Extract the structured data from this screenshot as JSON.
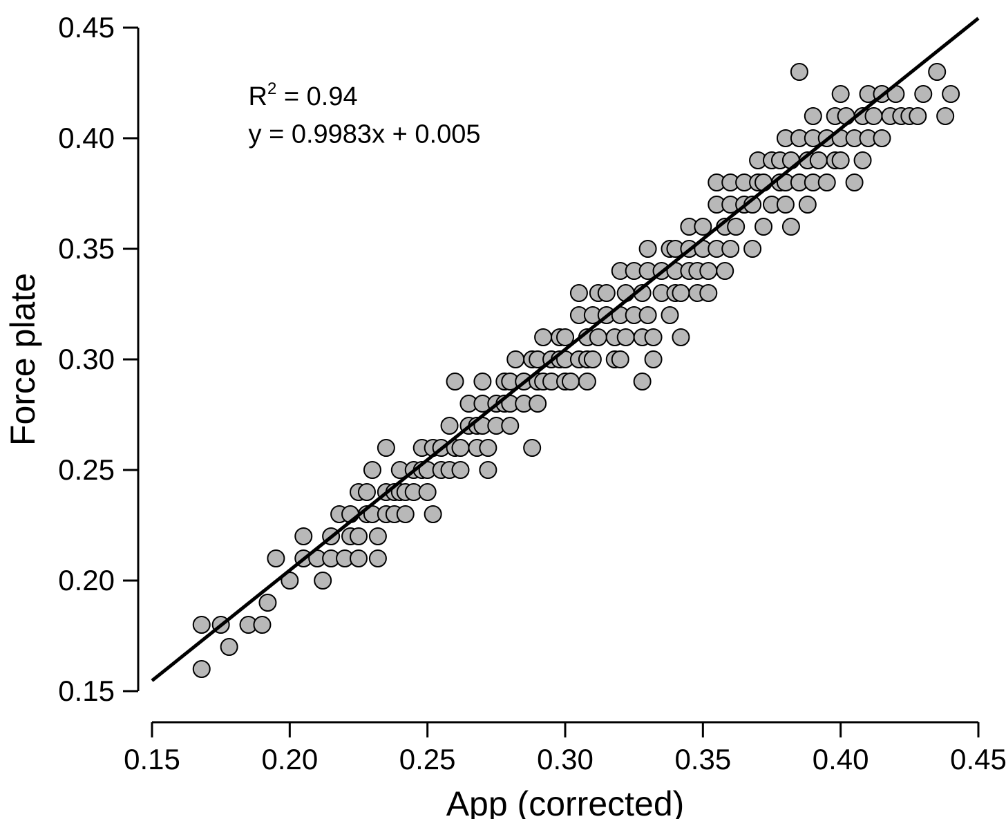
{
  "chart_data": {
    "type": "scatter",
    "xlabel": "App (corrected)",
    "ylabel": "Force plate",
    "xlim": [
      0.15,
      0.45
    ],
    "ylim": [
      0.15,
      0.45
    ],
    "xticks": [
      0.15,
      0.2,
      0.25,
      0.3,
      0.35,
      0.4,
      0.45
    ],
    "yticks": [
      0.15,
      0.2,
      0.25,
      0.3,
      0.35,
      0.4,
      0.45
    ],
    "xtick_labels": [
      "0.15",
      "0.20",
      "0.25",
      "0.30",
      "0.35",
      "0.40",
      "0.45"
    ],
    "ytick_labels": [
      "0.15",
      "0.20",
      "0.25",
      "0.30",
      "0.35",
      "0.40",
      "0.45"
    ],
    "annotations": {
      "r2_label": "R",
      "r2_sup": "2",
      "r2_rest": " = 0.94",
      "equation": "y = 0.9983x + 0.005"
    },
    "regression": {
      "slope": 0.9983,
      "intercept": 0.005,
      "x_start": 0.15,
      "x_end": 0.45
    },
    "points": [
      [
        0.168,
        0.16
      ],
      [
        0.168,
        0.18
      ],
      [
        0.175,
        0.18
      ],
      [
        0.178,
        0.17
      ],
      [
        0.185,
        0.18
      ],
      [
        0.19,
        0.18
      ],
      [
        0.192,
        0.19
      ],
      [
        0.195,
        0.21
      ],
      [
        0.2,
        0.2
      ],
      [
        0.205,
        0.21
      ],
      [
        0.205,
        0.22
      ],
      [
        0.21,
        0.21
      ],
      [
        0.212,
        0.2
      ],
      [
        0.215,
        0.21
      ],
      [
        0.215,
        0.22
      ],
      [
        0.218,
        0.23
      ],
      [
        0.22,
        0.21
      ],
      [
        0.222,
        0.22
      ],
      [
        0.222,
        0.23
      ],
      [
        0.225,
        0.24
      ],
      [
        0.225,
        0.22
      ],
      [
        0.225,
        0.21
      ],
      [
        0.228,
        0.23
      ],
      [
        0.228,
        0.24
      ],
      [
        0.23,
        0.23
      ],
      [
        0.23,
        0.25
      ],
      [
        0.232,
        0.21
      ],
      [
        0.232,
        0.22
      ],
      [
        0.235,
        0.23
      ],
      [
        0.235,
        0.24
      ],
      [
        0.235,
        0.26
      ],
      [
        0.238,
        0.23
      ],
      [
        0.238,
        0.24
      ],
      [
        0.24,
        0.24
      ],
      [
        0.24,
        0.25
      ],
      [
        0.242,
        0.23
      ],
      [
        0.242,
        0.24
      ],
      [
        0.245,
        0.25
      ],
      [
        0.245,
        0.24
      ],
      [
        0.248,
        0.25
      ],
      [
        0.248,
        0.26
      ],
      [
        0.25,
        0.25
      ],
      [
        0.25,
        0.24
      ],
      [
        0.252,
        0.23
      ],
      [
        0.252,
        0.26
      ],
      [
        0.255,
        0.25
      ],
      [
        0.255,
        0.26
      ],
      [
        0.258,
        0.25
      ],
      [
        0.258,
        0.27
      ],
      [
        0.26,
        0.26
      ],
      [
        0.26,
        0.29
      ],
      [
        0.262,
        0.25
      ],
      [
        0.262,
        0.26
      ],
      [
        0.265,
        0.27
      ],
      [
        0.265,
        0.28
      ],
      [
        0.268,
        0.26
      ],
      [
        0.268,
        0.27
      ],
      [
        0.27,
        0.27
      ],
      [
        0.27,
        0.28
      ],
      [
        0.27,
        0.29
      ],
      [
        0.272,
        0.26
      ],
      [
        0.272,
        0.25
      ],
      [
        0.275,
        0.27
      ],
      [
        0.275,
        0.28
      ],
      [
        0.278,
        0.28
      ],
      [
        0.278,
        0.29
      ],
      [
        0.28,
        0.28
      ],
      [
        0.28,
        0.29
      ],
      [
        0.28,
        0.27
      ],
      [
        0.282,
        0.3
      ],
      [
        0.285,
        0.28
      ],
      [
        0.285,
        0.29
      ],
      [
        0.288,
        0.3
      ],
      [
        0.288,
        0.26
      ],
      [
        0.29,
        0.28
      ],
      [
        0.29,
        0.29
      ],
      [
        0.29,
        0.3
      ],
      [
        0.292,
        0.29
      ],
      [
        0.292,
        0.31
      ],
      [
        0.295,
        0.29
      ],
      [
        0.295,
        0.3
      ],
      [
        0.298,
        0.3
      ],
      [
        0.298,
        0.31
      ],
      [
        0.3,
        0.29
      ],
      [
        0.3,
        0.3
      ],
      [
        0.3,
        0.31
      ],
      [
        0.302,
        0.29
      ],
      [
        0.305,
        0.3
      ],
      [
        0.305,
        0.32
      ],
      [
        0.305,
        0.33
      ],
      [
        0.308,
        0.29
      ],
      [
        0.308,
        0.3
      ],
      [
        0.308,
        0.31
      ],
      [
        0.31,
        0.3
      ],
      [
        0.31,
        0.32
      ],
      [
        0.312,
        0.31
      ],
      [
        0.312,
        0.33
      ],
      [
        0.315,
        0.32
      ],
      [
        0.315,
        0.33
      ],
      [
        0.318,
        0.3
      ],
      [
        0.318,
        0.31
      ],
      [
        0.32,
        0.32
      ],
      [
        0.32,
        0.34
      ],
      [
        0.32,
        0.3
      ],
      [
        0.322,
        0.31
      ],
      [
        0.322,
        0.33
      ],
      [
        0.325,
        0.32
      ],
      [
        0.325,
        0.34
      ],
      [
        0.328,
        0.29
      ],
      [
        0.328,
        0.31
      ],
      [
        0.328,
        0.33
      ],
      [
        0.33,
        0.32
      ],
      [
        0.33,
        0.34
      ],
      [
        0.33,
        0.35
      ],
      [
        0.332,
        0.3
      ],
      [
        0.332,
        0.31
      ],
      [
        0.335,
        0.33
      ],
      [
        0.335,
        0.34
      ],
      [
        0.338,
        0.32
      ],
      [
        0.338,
        0.35
      ],
      [
        0.34,
        0.33
      ],
      [
        0.34,
        0.34
      ],
      [
        0.34,
        0.35
      ],
      [
        0.342,
        0.31
      ],
      [
        0.342,
        0.33
      ],
      [
        0.345,
        0.34
      ],
      [
        0.345,
        0.35
      ],
      [
        0.345,
        0.36
      ],
      [
        0.348,
        0.33
      ],
      [
        0.348,
        0.34
      ],
      [
        0.35,
        0.35
      ],
      [
        0.35,
        0.36
      ],
      [
        0.352,
        0.33
      ],
      [
        0.352,
        0.34
      ],
      [
        0.355,
        0.35
      ],
      [
        0.355,
        0.37
      ],
      [
        0.355,
        0.38
      ],
      [
        0.358,
        0.34
      ],
      [
        0.358,
        0.36
      ],
      [
        0.36,
        0.35
      ],
      [
        0.36,
        0.37
      ],
      [
        0.36,
        0.38
      ],
      [
        0.362,
        0.36
      ],
      [
        0.365,
        0.37
      ],
      [
        0.365,
        0.38
      ],
      [
        0.368,
        0.35
      ],
      [
        0.368,
        0.37
      ],
      [
        0.37,
        0.38
      ],
      [
        0.37,
        0.39
      ],
      [
        0.372,
        0.36
      ],
      [
        0.372,
        0.38
      ],
      [
        0.375,
        0.37
      ],
      [
        0.375,
        0.39
      ],
      [
        0.378,
        0.38
      ],
      [
        0.378,
        0.39
      ],
      [
        0.38,
        0.37
      ],
      [
        0.38,
        0.38
      ],
      [
        0.38,
        0.4
      ],
      [
        0.382,
        0.36
      ],
      [
        0.382,
        0.39
      ],
      [
        0.385,
        0.38
      ],
      [
        0.385,
        0.4
      ],
      [
        0.385,
        0.43
      ],
      [
        0.388,
        0.37
      ],
      [
        0.388,
        0.39
      ],
      [
        0.39,
        0.38
      ],
      [
        0.39,
        0.4
      ],
      [
        0.39,
        0.41
      ],
      [
        0.392,
        0.39
      ],
      [
        0.395,
        0.4
      ],
      [
        0.395,
        0.38
      ],
      [
        0.398,
        0.39
      ],
      [
        0.398,
        0.41
      ],
      [
        0.4,
        0.39
      ],
      [
        0.4,
        0.4
      ],
      [
        0.4,
        0.42
      ],
      [
        0.402,
        0.41
      ],
      [
        0.405,
        0.38
      ],
      [
        0.405,
        0.4
      ],
      [
        0.408,
        0.39
      ],
      [
        0.408,
        0.41
      ],
      [
        0.41,
        0.4
      ],
      [
        0.41,
        0.42
      ],
      [
        0.412,
        0.41
      ],
      [
        0.415,
        0.4
      ],
      [
        0.415,
        0.42
      ],
      [
        0.418,
        0.41
      ],
      [
        0.42,
        0.42
      ],
      [
        0.422,
        0.41
      ],
      [
        0.425,
        0.41
      ],
      [
        0.428,
        0.41
      ],
      [
        0.43,
        0.42
      ],
      [
        0.435,
        0.43
      ],
      [
        0.438,
        0.41
      ],
      [
        0.44,
        0.42
      ]
    ]
  }
}
